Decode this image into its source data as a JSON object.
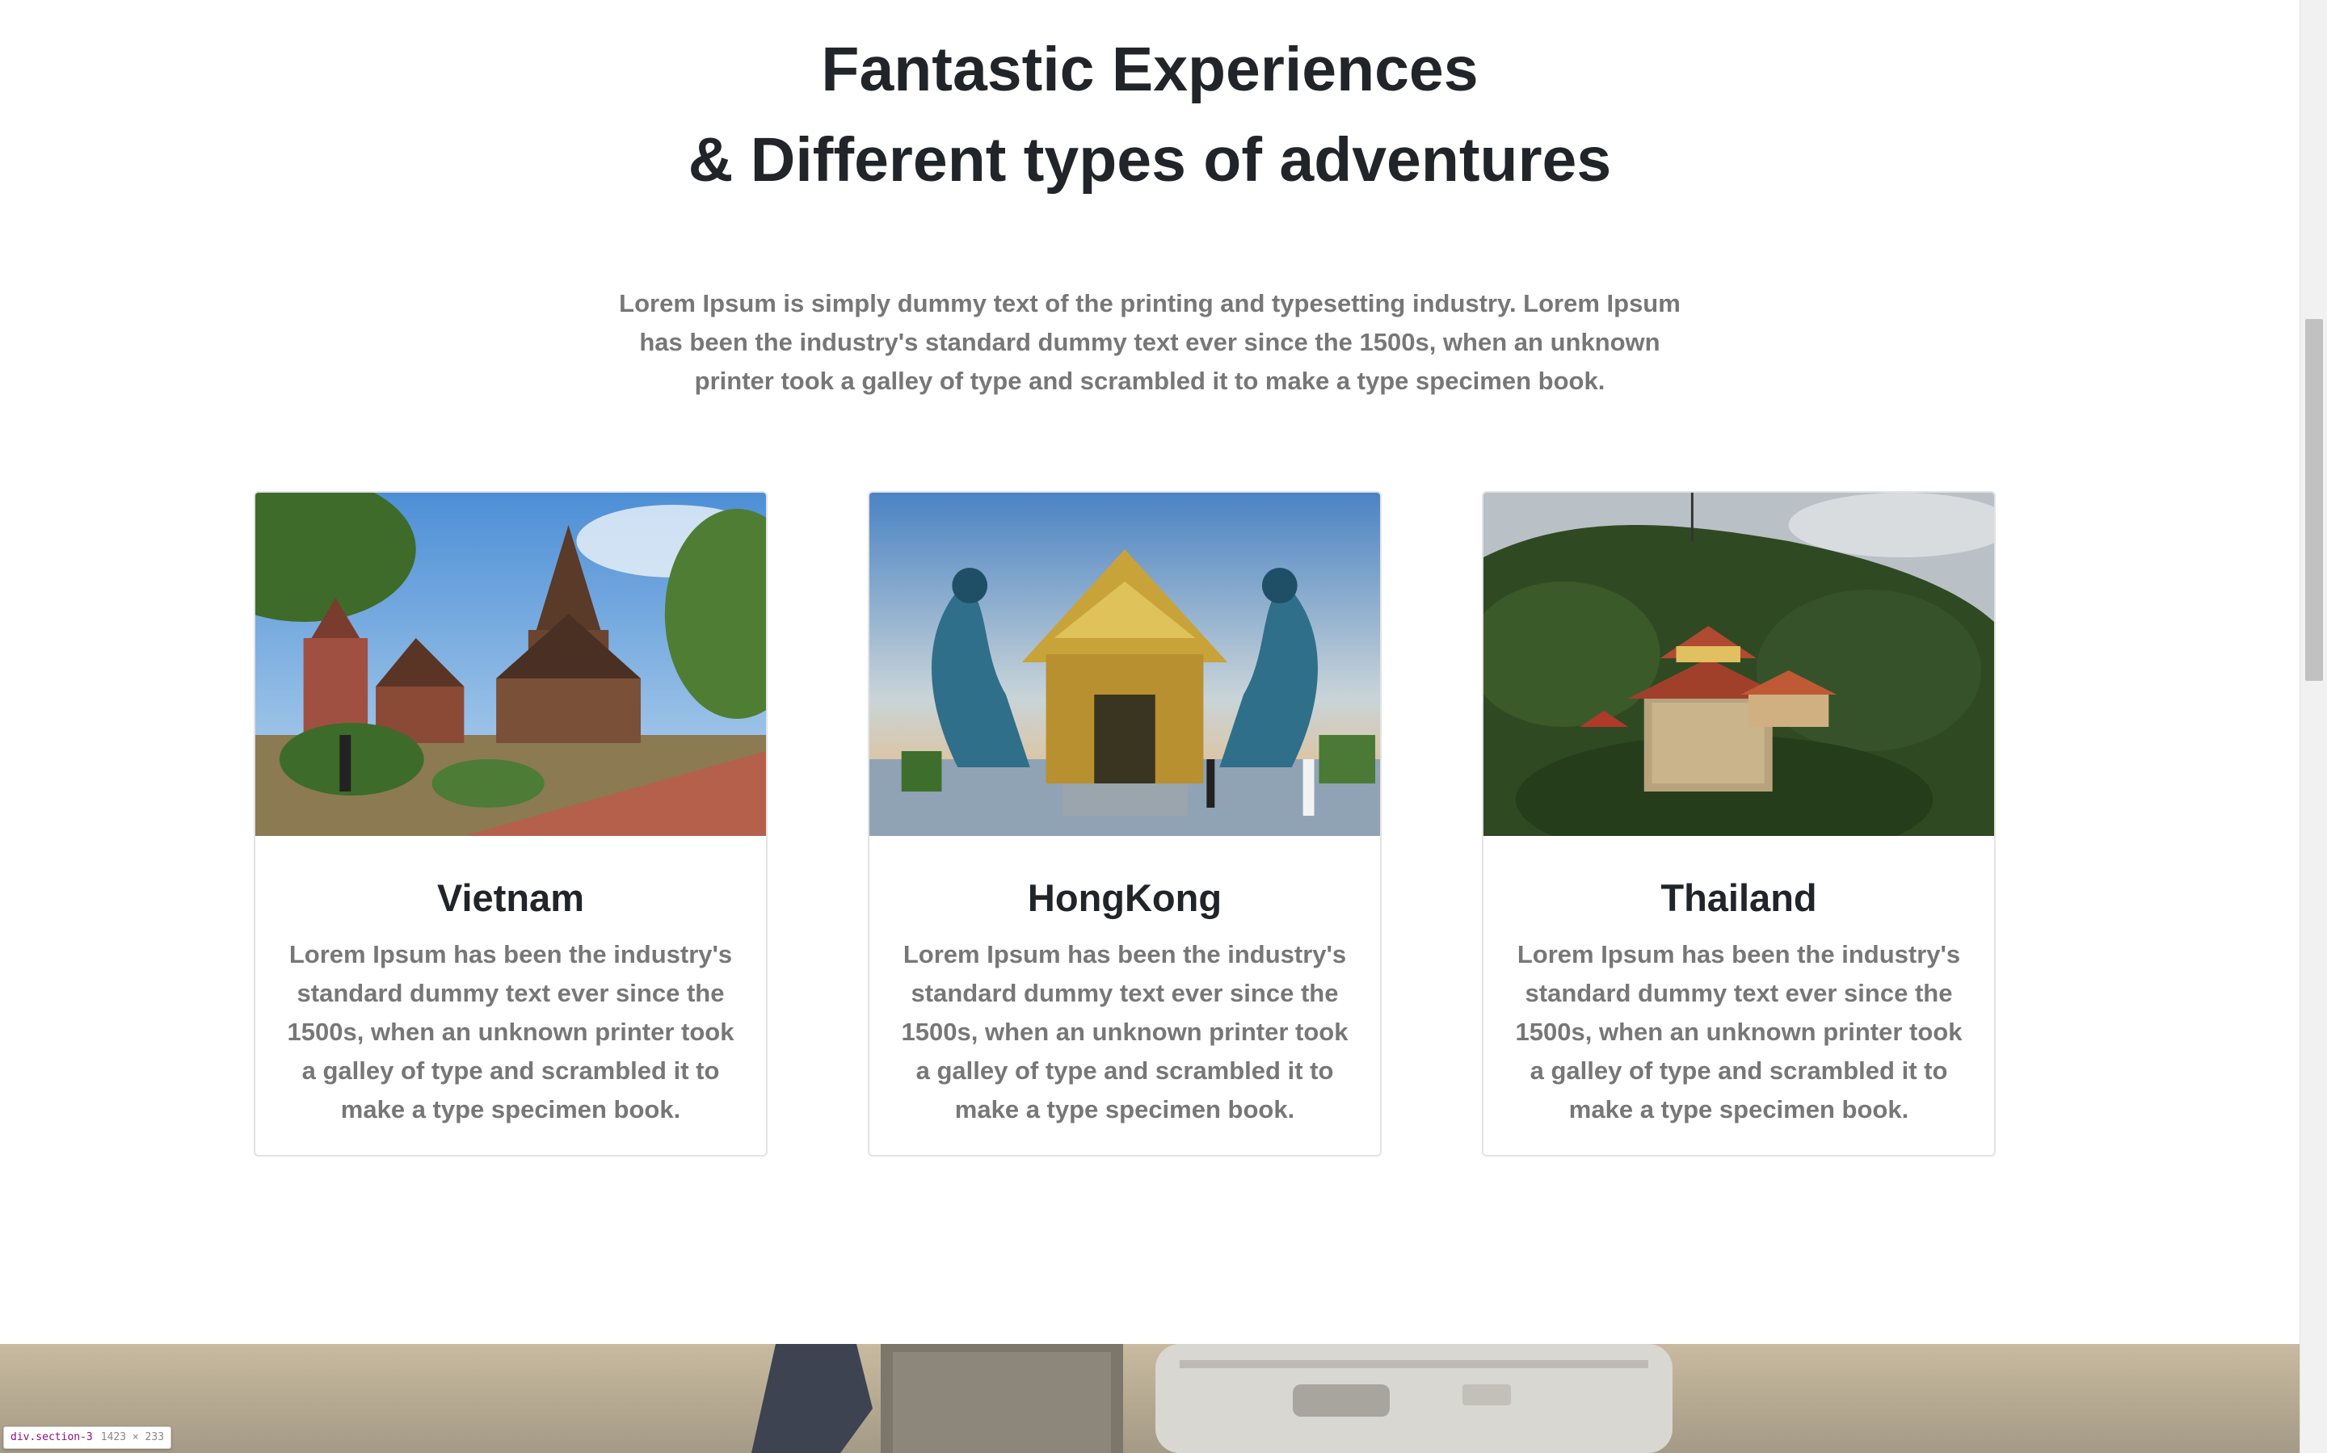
{
  "section": {
    "heading_line1": "Fantastic Experiences",
    "heading_line2": "& Different types of adventures",
    "intro": "Lorem Ipsum is simply dummy text of the printing and typesetting industry. Lorem Ipsum has been the industry's standard dummy text ever since the 1500s, when an unknown printer took a galley of type and scrambled it to make a type specimen book."
  },
  "cards": [
    {
      "title": "Vietnam",
      "text": "Lorem Ipsum has been the industry's standard dummy text ever since the 1500s, when an unknown printer took a galley of type and scrambled it to make a type specimen book.",
      "image": "wooden-pagoda-temple-photo"
    },
    {
      "title": "HongKong",
      "text": "Lorem Ipsum has been the industry's standard dummy text ever since the 1500s, when an unknown printer took a galley of type and scrambled it to make a type specimen book.",
      "image": "golden-temple-with-dragons-photo"
    },
    {
      "title": "Thailand",
      "text": "Lorem Ipsum has been the industry's standard dummy text ever since the 1500s, when an unknown printer took a galley of type and scrambled it to make a type specimen book.",
      "image": "hillside-temple-in-forest-photo"
    }
  ],
  "devtools": {
    "selector": "div.section-3",
    "size": "1423 × 233"
  },
  "colors": {
    "heading": "#212529",
    "body_text": "#777777",
    "card_border": "#e3e3e3"
  }
}
